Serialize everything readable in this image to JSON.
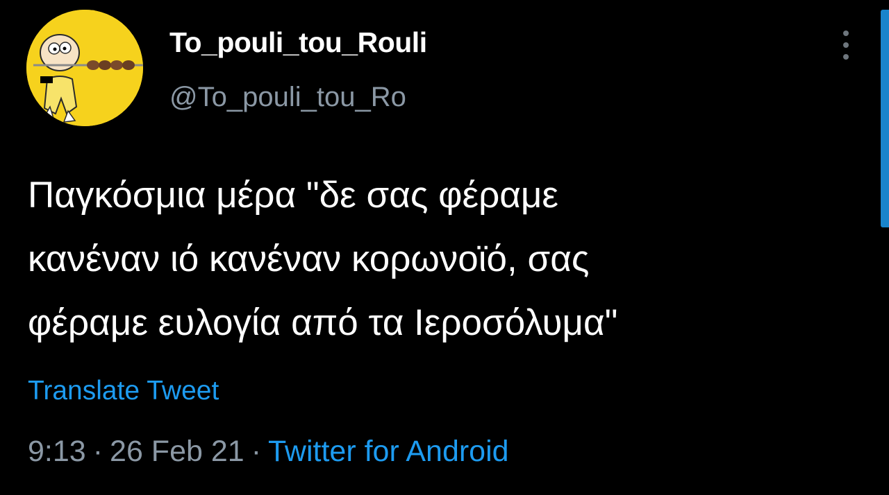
{
  "author": {
    "display_name": "To_pouli_tou_Rouli",
    "handle": "@To_pouli_tou_Ro",
    "avatar_icon": "cartoon-character-avatar-icon"
  },
  "tweet": {
    "lines": [
      "Παγκόσμια μέρα \"δε σας φέραμε",
      "κανέναν ιό κανέναν κορωνοϊό, σας",
      "φέραμε ευλογία από τα Ιεροσόλυμα\""
    ],
    "translate_label": "Translate Tweet"
  },
  "meta": {
    "time": "9:13",
    "separator": "·",
    "date": "26 Feb 21",
    "source": "Twitter for Android"
  },
  "icons": {
    "more": "more-vertical-icon"
  },
  "colors": {
    "background": "#000000",
    "text": "#ffffff",
    "secondary_text": "#8b98a5",
    "link": "#1d9bf0",
    "avatar_bg": "#f6d21d"
  }
}
